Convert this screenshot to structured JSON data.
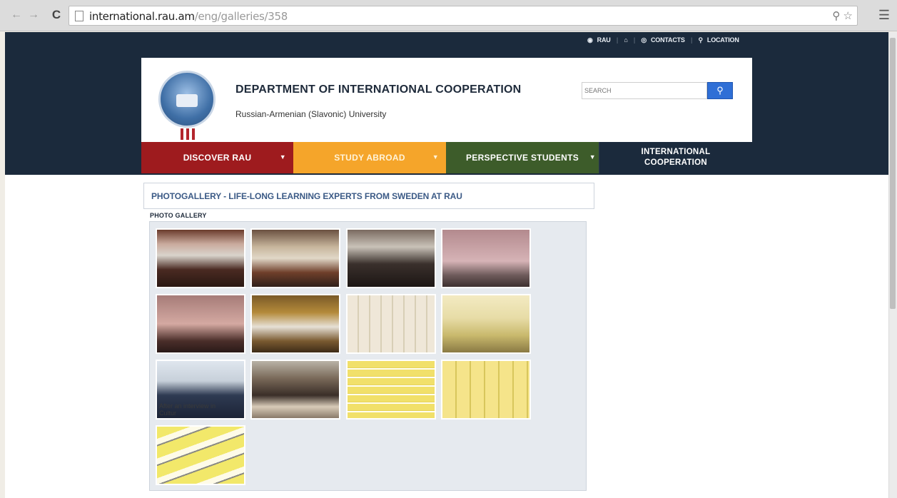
{
  "browser": {
    "url_domain": "international.rau.am",
    "url_path": "/eng/galleries/358",
    "back_icon": "back-arrow-icon",
    "forward_icon": "forward-arrow-icon",
    "reload_icon": "reload-icon"
  },
  "toplinks": {
    "rau": "RAU",
    "contacts": "CONTACTS",
    "location": "LOCATION"
  },
  "header": {
    "title": "DEPARTMENT OF INTERNATIONAL COOPERATION",
    "subtitle": "Russian-Armenian (Slavonic) University",
    "search_placeholder": "SEARCH"
  },
  "menu": [
    {
      "label": "DISCOVER RAU",
      "color": "#9e1b1e"
    },
    {
      "label": "STUDY ABROAD",
      "color": "#f5a52a"
    },
    {
      "label": "PERSPECTIVE STUDENTS",
      "color": "#3d5c2a"
    },
    {
      "label": "INTERNATIONAL COOPERATION",
      "color": "#1b2a3c"
    }
  ],
  "content": {
    "page_title": "PHOTOGALLERY - LIFE-LONG LEARNING EXPERTS FROM SWEDEN AT RAU",
    "gallery_label": "PHOTO GALLERY",
    "thumb_caption": "After an interview in Cultur"
  }
}
